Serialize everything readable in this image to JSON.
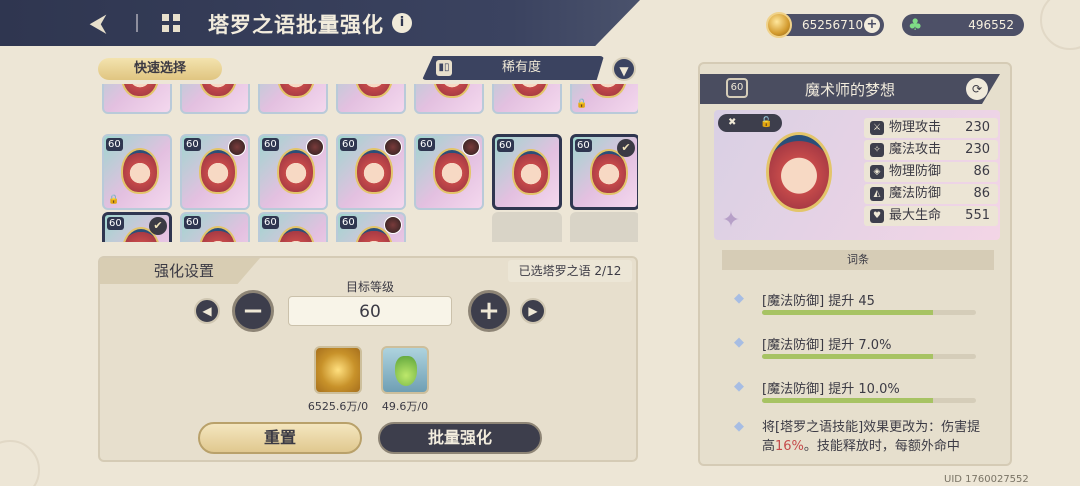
{
  "header": {
    "title": "塔罗之语批量强化",
    "info_icon": "info-icon"
  },
  "currency": {
    "gold": "65256710",
    "gem": "496552"
  },
  "left": {
    "quick_select": "快速选择",
    "sort_label": "稀有度",
    "cards_row2_levels": [
      "60",
      "60",
      "60",
      "60",
      "60",
      "60",
      "60"
    ],
    "cards_row3_levels": [
      "60",
      "60",
      "60",
      "60"
    ]
  },
  "settings": {
    "title": "强化设置",
    "selected_count": "已选塔罗之语 2/12",
    "target_label": "目标等级",
    "target_level": "60",
    "materials": [
      {
        "name": "coin",
        "amount": "6525.6万/0"
      },
      {
        "name": "potion",
        "amount": "49.6万/0"
      }
    ],
    "reset_label": "重置",
    "batch_label": "批量强化"
  },
  "right": {
    "level": "60",
    "title": "魔术师的梦想",
    "stats": [
      {
        "name": "物理攻击",
        "value": "230"
      },
      {
        "name": "魔法攻击",
        "value": "230"
      },
      {
        "name": "物理防御",
        "value": "86"
      },
      {
        "name": "魔法防御",
        "value": "86"
      },
      {
        "name": "最大生命",
        "value": "551"
      }
    ],
    "entries_header": "词条",
    "entries": [
      {
        "text": "[魔法防御] 提升 45",
        "progress": 0.8
      },
      {
        "text": "[魔法防御] 提升 7.0%",
        "progress": 0.8
      },
      {
        "text": "[魔法防御] 提升 10.0%",
        "progress": 0.8
      }
    ],
    "long_entry_a": "将[塔罗之语技能]效果更改为：伤害提高",
    "long_entry_red": "16%",
    "long_entry_b": "。技能释放时，每额外命中"
  },
  "uid": "UID 1760027552"
}
